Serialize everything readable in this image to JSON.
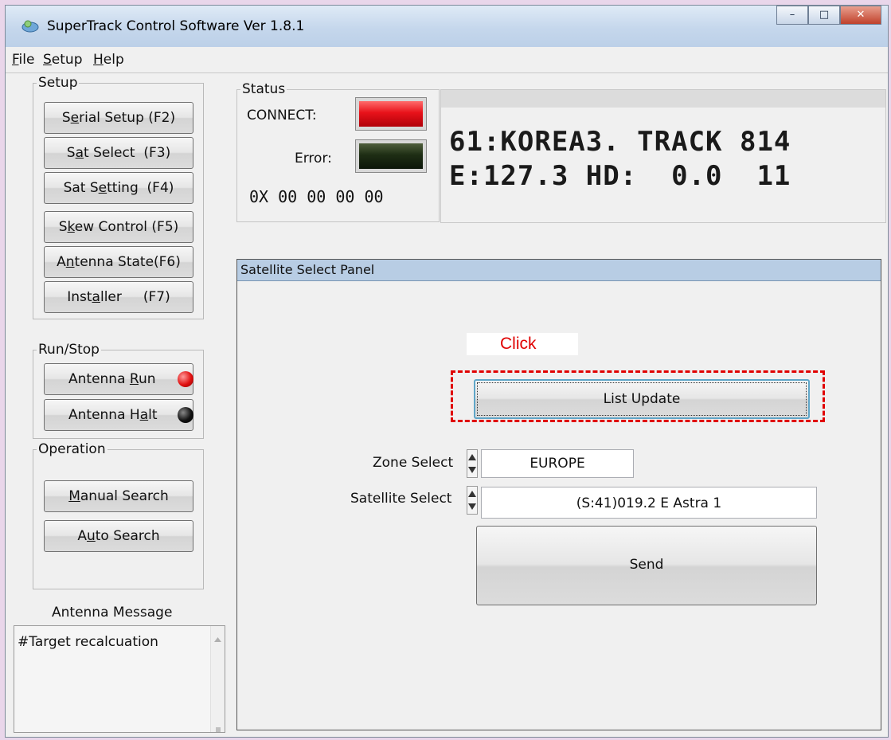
{
  "window": {
    "title": "SuperTrack Control Software Ver 1.8.1"
  },
  "menu": [
    {
      "label": "File",
      "underline": "F",
      "rest": "ile"
    },
    {
      "label": "Setup",
      "underline": "S",
      "rest": "etup"
    },
    {
      "label": "Help",
      "underline": "H",
      "rest": "elp"
    }
  ],
  "setup_group": {
    "label": "Setup",
    "buttons": [
      {
        "pre": "S",
        "u": "e",
        "post": "rial Setup (F2)"
      },
      {
        "pre": "S",
        "u": "a",
        "post": "t Select  (F3)"
      },
      {
        "pre": "Sat S",
        "u": "e",
        "post": "tting  (F4)"
      },
      {
        "pre": "S",
        "u": "k",
        "post": "ew Control (F5)"
      },
      {
        "pre": "A",
        "u": "n",
        "post": "tenna State(F6)"
      },
      {
        "pre": "Inst",
        "u": "a",
        "post": "ller     (F7)"
      }
    ]
  },
  "runstop_group": {
    "label": "Run/Stop",
    "run": {
      "pre": "Antenna ",
      "u": "R",
      "post": "un"
    },
    "halt": {
      "pre": "Antenna H",
      "u": "a",
      "post": "lt"
    }
  },
  "operation_group": {
    "label": "Operation",
    "manual": {
      "pre": "",
      "u": "M",
      "post": "anual Search"
    },
    "auto": {
      "pre": "A",
      "u": "u",
      "post": "to Search"
    }
  },
  "antenna_message": {
    "label": "Antenna Message",
    "text": "#Target recalcuation"
  },
  "status": {
    "label": "Status",
    "connect_label": "CONNECT:",
    "error_label": "Error:",
    "hex": "0X 00 00 00 00",
    "connect_color": "#e8121a",
    "error_color": "#1e2e14"
  },
  "lcd": {
    "line1": "61:KOREA3. TRACK 814",
    "line2": "E:127.3 HD:  0.0  11"
  },
  "panel": {
    "title": "Satellite Select Panel",
    "annotation": "Click",
    "list_update": "List Update",
    "zone_label": "Zone Select",
    "zone_value": "EUROPE",
    "satellite_label": "Satellite Select",
    "satellite_value": "(S:41)019.2 E  Astra 1",
    "send": "Send"
  },
  "colors": {
    "annotation_red": "#e00000",
    "run_led": "#e01010",
    "halt_led": "#111111"
  }
}
